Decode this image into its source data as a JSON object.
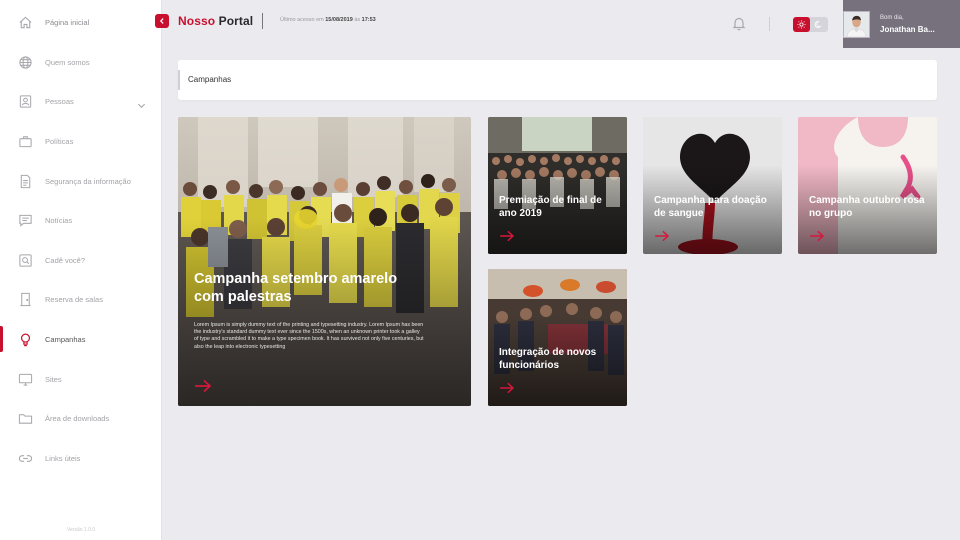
{
  "sidebar": {
    "items": [
      {
        "label": "Página inicial",
        "icon": "home-icon"
      },
      {
        "label": "Quem somos",
        "icon": "globe-icon"
      },
      {
        "label": "Pessoas",
        "icon": "person-icon"
      },
      {
        "label": "Políticas",
        "icon": "briefcase-icon"
      },
      {
        "label": "Segurança da informação",
        "icon": "document-icon"
      },
      {
        "label": "Notícias",
        "icon": "chat-icon"
      },
      {
        "label": "Cadê você?",
        "icon": "search-icon"
      },
      {
        "label": "Reserva de salas",
        "icon": "door-icon"
      },
      {
        "label": "Campanhas",
        "icon": "lightbulb-icon"
      },
      {
        "label": "Sites",
        "icon": "monitor-icon"
      },
      {
        "label": "Área de downloads",
        "icon": "folder-icon"
      },
      {
        "label": "Links úteis",
        "icon": "link-icon"
      }
    ],
    "active_index": 8,
    "version": "Versão 1.0.0"
  },
  "header": {
    "brand_part1": "Nosso",
    "brand_part2": "Portal",
    "last_access_prefix": "Último acesso em",
    "last_access_date": "15/08/2019",
    "last_access_mid": "às",
    "last_access_time": "17:53",
    "greeting": "Bom dia,",
    "user_name": "Jonathan Ba..."
  },
  "breadcrumb": "Campanhas",
  "cards": [
    {
      "title": "Campanha setembro amarelo com palestras",
      "description": "Lorem Ipsum is simply dummy text of the printing and typesetting industry. Lorem Ipsum has been the industry's standard dummy text ever since the 1500s, when an unknown printer took a galley of type and scrambled it to make a type specimen book. It has survived not only five centuries, but also the leap into electronic typesetting"
    },
    {
      "title": "Premiação de final de ano 2019"
    },
    {
      "title": "Campanha para doação de sangue"
    },
    {
      "title": "Campanha outubro rosa no grupo"
    },
    {
      "title": "Integração de novos funcionários"
    }
  ],
  "colors": {
    "accent": "#c8102e",
    "background": "#ebeaef",
    "user_panel": "#77717d"
  }
}
